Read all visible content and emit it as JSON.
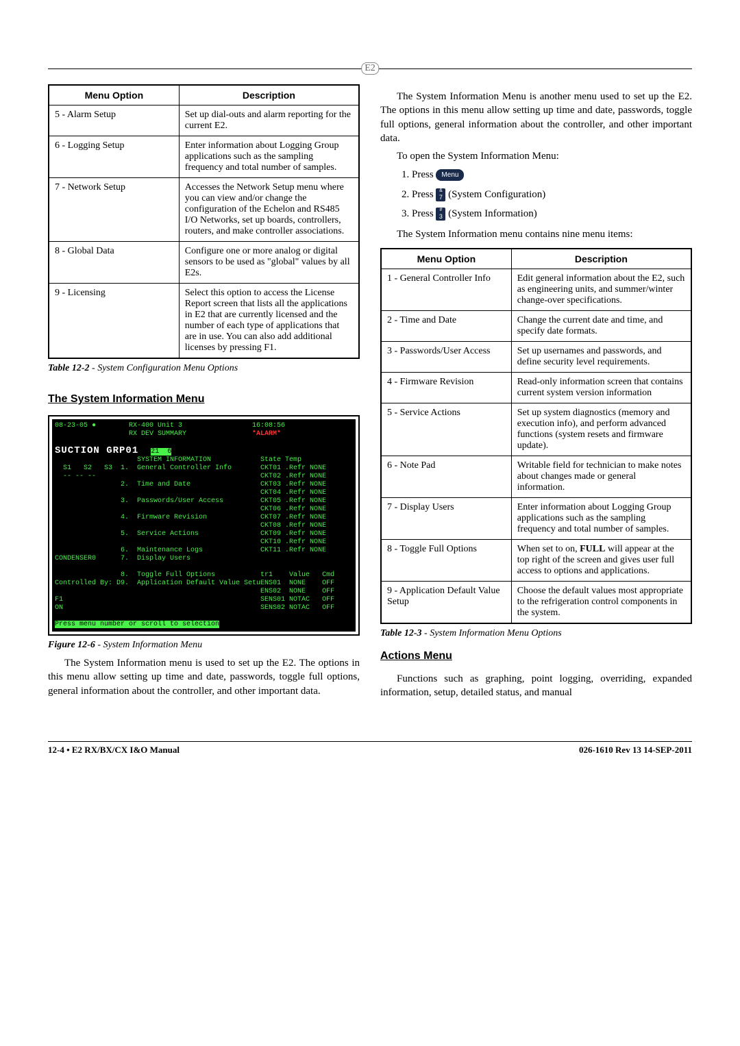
{
  "header_logo": "E2",
  "left": {
    "table_header_option": "Menu Option",
    "table_header_desc": "Description",
    "rows": [
      {
        "option": "5 - Alarm Setup",
        "desc": "Set up dial-outs and alarm reporting for the current E2."
      },
      {
        "option": "6 - Logging Setup",
        "desc": "Enter information about Logging Group applications such as the sampling frequency and total number of samples."
      },
      {
        "option": "7 - Network Setup",
        "desc": "Accesses the Network Setup menu where you can view and/or change the configuration of the Echelon and RS485 I/O Networks, set up boards, controllers, routers, and make controller associations."
      },
      {
        "option": "8 - Global Data",
        "desc": "Configure one or more analog or digital sensors to be used as \"global\" values by all E2s."
      },
      {
        "option": "9 - Licensing",
        "desc": "Select this option to access the License Report screen that lists all the applications in E2 that are currently licensed and the number of each type of applications that are in use. You can also add additional licenses by pressing F1."
      }
    ],
    "table_caption_label": "Table 12-2",
    "table_caption_text": " - System Configuration Menu Options",
    "section_title": "The System Information Menu",
    "figure_caption_label": "Figure 12-6",
    "figure_caption_text": " - System Information Menu",
    "para1": "The System Information menu is used to set up the E2. The options in this menu allow setting up time and date, passwords, toggle full options, general information about the controller, and other important data.",
    "terminal": {
      "date": "08-23-05",
      "unit": "RX-400 Unit 3",
      "summary": "RX DEV SUMMARY",
      "time": "16:08:56",
      "alarm": "*ALARM*",
      "title_left": "SUCTION GRP01",
      "subheading": "SYSTEM INFORMATION",
      "menu": [
        "1.  General Controller Info",
        "2.  Time and Date",
        "3.  Passwords/User Access",
        "4.  Firmware Revision",
        "5.  Service Actions",
        "6.  Maintenance Logs",
        "7.  Display Users",
        "8.  Toggle Full Options",
        "9.  Application Default Value Setup"
      ],
      "right_header": "State Temp",
      "right_rows": [
        "CKT01 .Refr NONE",
        "CKT02 .Refr NONE",
        "CKT03 .Refr NONE",
        "CKT04 .Refr NONE",
        "CKT05 .Refr NONE",
        "CKT06 .Refr NONE",
        "CKT07 .Refr NONE",
        "CKT08 .Refr NONE",
        "CKT09 .Refr NONE",
        "CKT10 .Refr NONE",
        "CKT11 .Refr NONE"
      ],
      "cond_row": "CONDENSER0",
      "s_row": "S1   S2   S3",
      "controlled": "Controlled By: Dis",
      "tr_header": "tr1    Value   Cmd",
      "tr_rows": [
        "ENS01  NONE    OFF",
        "ENS02  NONE    OFF",
        "SENS01 NOTAC   OFF",
        "SENS02 NOTAC   OFF"
      ],
      "f1_on": "F1\nON",
      "hint": "Press menu number or scroll to selection"
    }
  },
  "right": {
    "para_top": "The System Information Menu is another menu used to set up the E2. The options in this menu allow setting up time and date, passwords, toggle full options, general information about the controller, and other important data.",
    "open_line": "To open the System Information Menu:",
    "step_press": "Press",
    "step1_key": "Menu",
    "step2_key_top": "&",
    "step2_key_bottom": "7",
    "step2_tail": " (System Configuration)",
    "step3_key_top": "#",
    "step3_key_bottom": "3",
    "step3_tail": " (System Information)",
    "para_items": "The System Information menu contains nine menu items:",
    "table_header_option": "Menu Option",
    "table_header_desc": "Description",
    "rows": [
      {
        "option": "1 - General Controller Info",
        "desc": "Edit general information about the E2, such as engineering units, and summer/winter change-over specifications."
      },
      {
        "option": "2 - Time and Date",
        "desc": "Change the current date and time, and specify date formats."
      },
      {
        "option": "3 - Passwords/User Access",
        "desc": "Set up usernames and passwords, and define security level requirements."
      },
      {
        "option": "4 - Firmware Revision",
        "desc": "Read-only information screen that contains current system version information"
      },
      {
        "option": "5 - Service Actions",
        "desc": "Set up system diagnostics (memory and execution info), and perform advanced functions (system resets and firmware update)."
      },
      {
        "option": "6 - Note Pad",
        "desc": "Writable field for technician to make notes about changes made or general information."
      },
      {
        "option": "7 - Display Users",
        "desc": "Enter information about Logging Group applications such as the sampling frequency and total number of samples."
      },
      {
        "option": "8 - Toggle Full Options",
        "desc_html": "When set to on, <span class=\"b\">FULL</span> will appear at the top right of the screen and gives user full access to options and applications."
      },
      {
        "option": "9 - Application Default Value Setup",
        "desc": "Choose the default values most appropriate to the refrigeration control components in the system."
      }
    ],
    "table_caption_label": "Table 12-3",
    "table_caption_text": " - System Information Menu Options",
    "section_title": "Actions Menu",
    "para_actions": "Functions such as graphing, point logging, overriding, expanded information, setup, detailed status, and manual"
  },
  "footer_left": "12-4 • E2 RX/BX/CX I&O Manual",
  "footer_right": "026-1610 Rev 13 14-SEP-2011"
}
